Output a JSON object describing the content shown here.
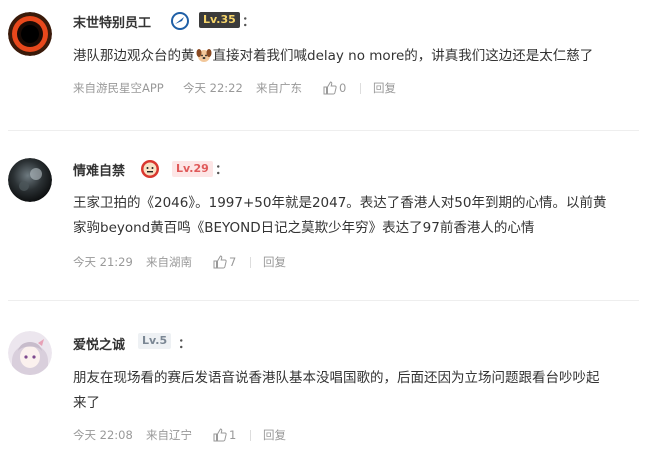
{
  "comments": [
    {
      "username": "末世特别员工",
      "level": "Lv.35",
      "level_bg": "#3b3b3b",
      "level_fg": "#f5d469",
      "text_before": "港队那边观众台的黄",
      "text_after": "直接对着我们喊delay no more的，讲真我们这边还是太仁慈了",
      "inline_emoji": "dog-face-emoji",
      "source": "来自游民星空APP",
      "time": "今天 22:22",
      "location": "来自广东",
      "likes": "0",
      "reply_label": "回复"
    },
    {
      "username": "情难自禁",
      "level": "Lv.29",
      "level_bg": "#fde6e6",
      "level_fg": "#e05a5a",
      "line1": "王家卫拍的《2046》。1997+50年就是2047。表达了香港人对50年到期的心情。以前黄",
      "line2": "家驹beyond黄百鸣《BEYOND日记之莫欺少年穷》表达了97前香港人的心情",
      "time": "今天 21:29",
      "location": "来自湖南",
      "likes": "7",
      "reply_label": "回复"
    },
    {
      "username": "爱悦之诚",
      "level": "Lv.5",
      "level_bg": "#eef1f4",
      "level_fg": "#7b8794",
      "line1": "朋友在现场看的赛后发语音说香港队基本没唱国歌的，后面还因为立场问题跟看台吵吵起",
      "line2": "来了",
      "time": "今天 22:08",
      "location": "来自辽宁",
      "likes": "1",
      "reply_label": "回复"
    }
  ],
  "colon": "："
}
